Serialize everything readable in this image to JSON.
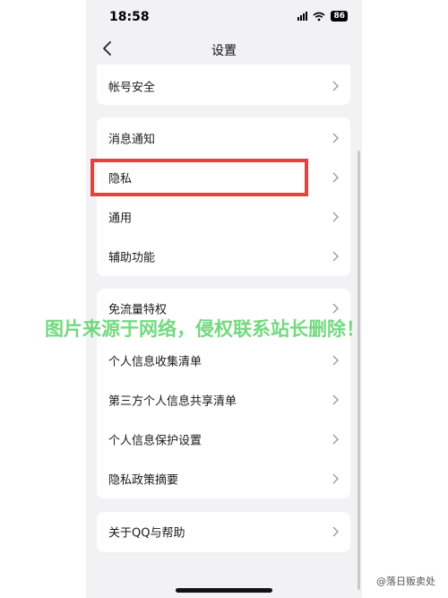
{
  "status_bar": {
    "time": "18:58",
    "battery": "86"
  },
  "nav": {
    "title": "设置"
  },
  "groups": [
    {
      "items": [
        {
          "label": "帐号安全"
        }
      ]
    },
    {
      "items": [
        {
          "label": "消息通知"
        },
        {
          "label": "隐私"
        },
        {
          "label": "通用"
        },
        {
          "label": "辅助功能"
        }
      ]
    },
    {
      "items": [
        {
          "label": "免流量特权"
        },
        {
          "label": "个人信息收集清单"
        },
        {
          "label": "第三方个人信息共享清单"
        },
        {
          "label": "个人信息保护设置"
        },
        {
          "label": "隐私政策摘要"
        }
      ]
    },
    {
      "items": [
        {
          "label": "关于QQ与帮助"
        }
      ]
    }
  ],
  "watermark": "图片来源于网络，侵权联系站长删除！",
  "credit": "@落日贩卖处",
  "colors": {
    "highlight": "#e8403b",
    "watermark": "#5bd36a",
    "background": "#f2f2f4"
  },
  "icons": {
    "back": "chevron-left-icon",
    "row": "chevron-right-icon"
  }
}
